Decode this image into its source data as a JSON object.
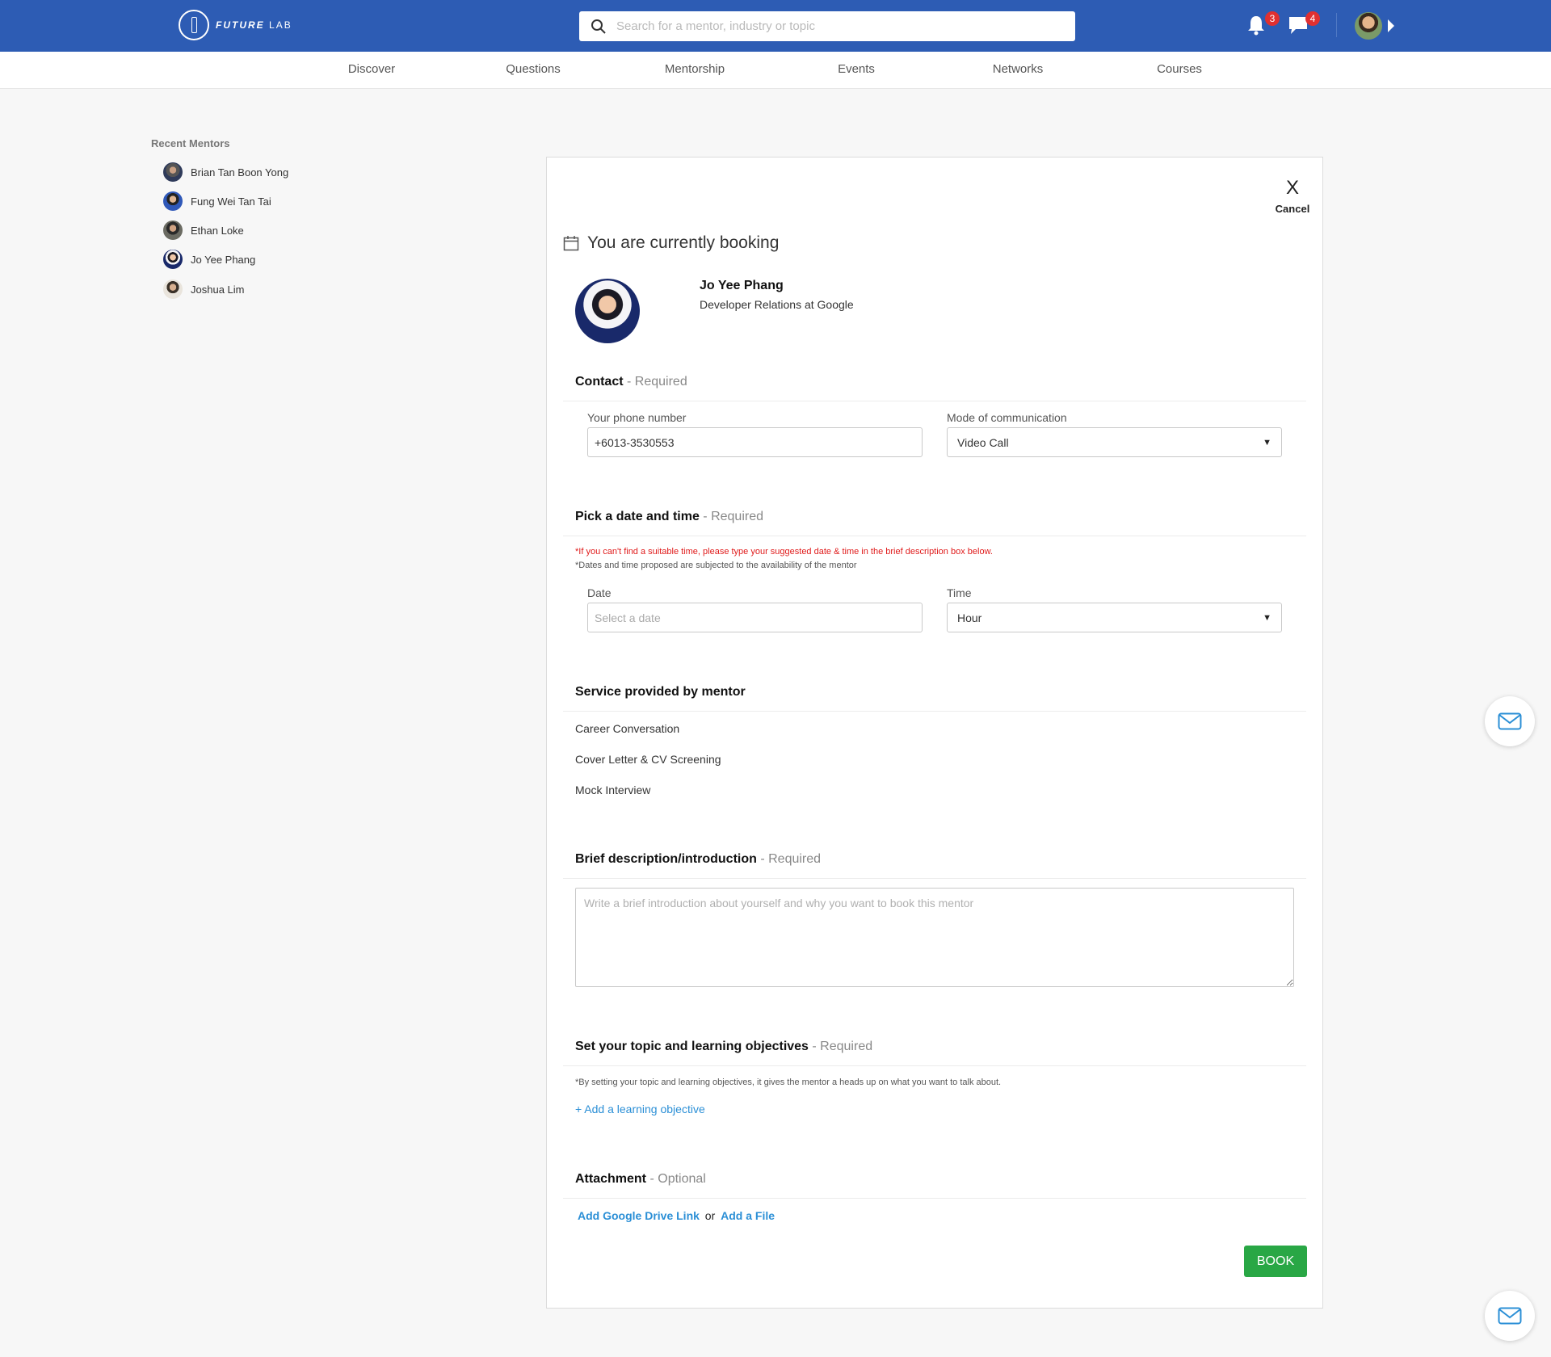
{
  "header": {
    "logo_text_bold": "FUTURE",
    "logo_text_light": "LAB",
    "search_placeholder": "Search for a mentor, industry or topic",
    "notifications_count": "3",
    "messages_count": "4"
  },
  "nav": {
    "items": [
      "Discover",
      "Questions",
      "Mentorship",
      "Events",
      "Networks",
      "Courses"
    ]
  },
  "sidebar": {
    "title": "Recent Mentors",
    "mentors": [
      "Brian Tan Boon Yong",
      "Fung Wei Tan Tai",
      "Ethan Loke",
      "Jo Yee Phang",
      "Joshua Lim"
    ]
  },
  "booking": {
    "cancel_icon": "X",
    "cancel_label": "Cancel",
    "title": "You are currently booking",
    "mentor_name": "Jo Yee Phang",
    "mentor_role": "Developer Relations at Google",
    "contact": {
      "heading": "Contact",
      "required": "- Required",
      "phone_label": "Your phone number",
      "phone_value": "+6013-3530553",
      "mode_label": "Mode of communication",
      "mode_value": "Video Call"
    },
    "datetime": {
      "heading": "Pick a date and time",
      "required": "- Required",
      "note_red": "*If you can't find a suitable time, please type your suggested date & time in the brief description box below.",
      "note_grey": "*Dates and time proposed are subjected to the availability of the mentor",
      "date_label": "Date",
      "date_placeholder": "Select a date",
      "time_label": "Time",
      "time_value": "Hour"
    },
    "services": {
      "heading": "Service provided by mentor",
      "items": [
        "Career Conversation",
        "Cover Letter & CV Screening",
        "Mock Interview"
      ]
    },
    "description": {
      "heading": "Brief description/introduction",
      "required": "- Required",
      "placeholder": "Write a brief introduction about yourself and why you want to book this mentor"
    },
    "objectives": {
      "heading": "Set your topic and learning objectives",
      "required": "- Required",
      "note": "*By setting your topic and learning objectives, it gives the mentor a heads up on what you want to talk about.",
      "add_link": "+ Add a learning objective"
    },
    "attachment": {
      "heading": "Attachment",
      "optional": "- Optional",
      "drive_link": "Add Google Drive Link",
      "or": "or",
      "file_link": "Add a File"
    },
    "book_label": "BOOK"
  },
  "colors": {
    "header_bg": "#2d5cb4",
    "accent_link": "#2b8fd6",
    "book_button": "#29a745",
    "badge": "#e03030",
    "warning_text": "#e01b1b"
  },
  "icons": [
    "search-icon",
    "bell-icon",
    "chat-icon",
    "calendar-icon",
    "close-icon",
    "mail-icon",
    "chevron-down-icon"
  ]
}
